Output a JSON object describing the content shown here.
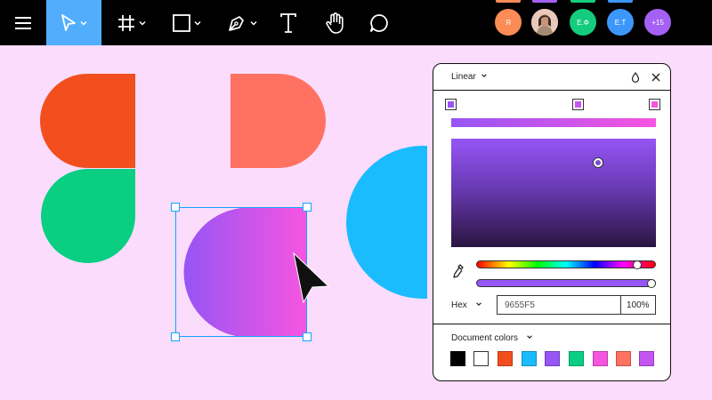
{
  "toolbar": {
    "tools": [
      {
        "name": "main-menu",
        "icon": "hamburger-icon"
      },
      {
        "name": "move-tool",
        "icon": "cursor-arrow-icon",
        "active": true
      },
      {
        "name": "frame-tool",
        "icon": "hash-frame-icon"
      },
      {
        "name": "shape-tool",
        "icon": "square-icon"
      },
      {
        "name": "pen-tool",
        "icon": "pen-nib-icon"
      },
      {
        "name": "text-tool",
        "icon": "type-icon"
      },
      {
        "name": "hand-tool",
        "icon": "hand-icon"
      },
      {
        "name": "comment-tool",
        "icon": "comment-bubble-icon"
      }
    ],
    "active_color": "#52aefc",
    "collaborators": [
      {
        "initials": "Я",
        "color": "#fc8c56"
      },
      {
        "initials": "",
        "color": "#f7c0b0",
        "photo": true
      },
      {
        "initials": "Е.Ф",
        "color": "#14cc7e"
      },
      {
        "initials": "Е.Т",
        "color": "#3d97fb"
      },
      {
        "initials": "+15",
        "color": "#a560f5"
      }
    ]
  },
  "canvas": {
    "background": "#fcdcfc",
    "colors": {
      "red": "#f24e1e",
      "coral": "#ff7262",
      "green": "#0acf83",
      "blue": "#1abcfe"
    },
    "selected_gradient": [
      "#9655f5",
      "#f655e0"
    ]
  },
  "panel": {
    "fill_type": "Linear",
    "gradient_stops": [
      {
        "color": "#9655f5"
      },
      {
        "color": "#c455f0"
      },
      {
        "color": "#f655e0"
      }
    ],
    "hex_label": "Hex",
    "hex_value": "9655F5",
    "opacity": "100%",
    "document_colors_label": "Document colors",
    "document_colors": [
      "#000000",
      "#ffffff",
      "#f24e1e",
      "#1abcfe",
      "#9655f5",
      "#0acf83",
      "#f655e0",
      "#ff7262",
      "#c455f0"
    ]
  }
}
